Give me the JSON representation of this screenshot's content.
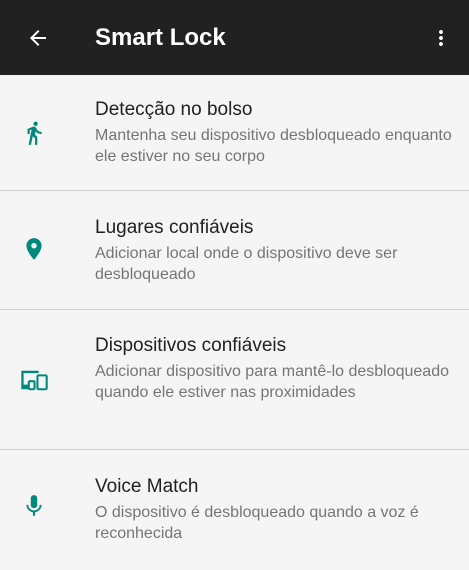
{
  "app_bar": {
    "title": "Smart Lock",
    "back_icon": "arrow-back-icon",
    "more_icon": "more-vert-icon"
  },
  "colors": {
    "app_bar_background": "#212121",
    "accent": "#00897b",
    "background": "#f5f5f5",
    "title_text": "#212121",
    "summary_text": "#757575"
  },
  "items": [
    {
      "icon": "walking-person-icon",
      "title": "Detecção no bolso",
      "summary": "Mantenha seu dispositivo desbloqueado enquanto ele estiver no seu corpo"
    },
    {
      "icon": "location-pin-icon",
      "title": "Lugares confiáveis",
      "summary": "Adicionar local onde o dispositivo deve ser desbloqueado"
    },
    {
      "icon": "devices-icon",
      "title": "Dispositivos confiáveis",
      "summary": "Adicionar dispositivo para mantê-lo desbloqueado quando ele estiver nas proximidades"
    },
    {
      "icon": "microphone-icon",
      "title": "Voice Match",
      "summary": "O dispositivo é desbloqueado quando a voz é reconhecida"
    }
  ]
}
